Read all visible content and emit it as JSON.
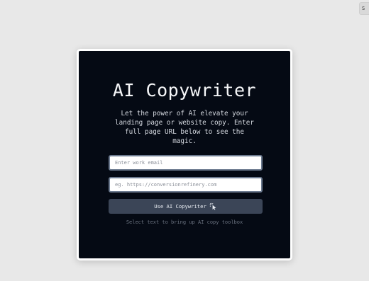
{
  "corner_tab": {
    "label": "S"
  },
  "card": {
    "title": "AI Copywriter",
    "subtitle": "Let the power of AI elevate your landing page or website copy. Enter full page URL below to see the magic.",
    "email_input": {
      "value": "",
      "placeholder": "Enter work email"
    },
    "url_input": {
      "value": "",
      "placeholder": "eg. https://conversionrefinery.com"
    },
    "cta_label": "Use AI Copywriter",
    "cta_icon": "magic-cursor-icon",
    "hint": "Select text to bring up AI copy toolbox"
  },
  "colors": {
    "page_background": "#e8e8e8",
    "card_background": "#050a14",
    "button_background": "#3b4557",
    "input_border": "#6d7b90"
  }
}
